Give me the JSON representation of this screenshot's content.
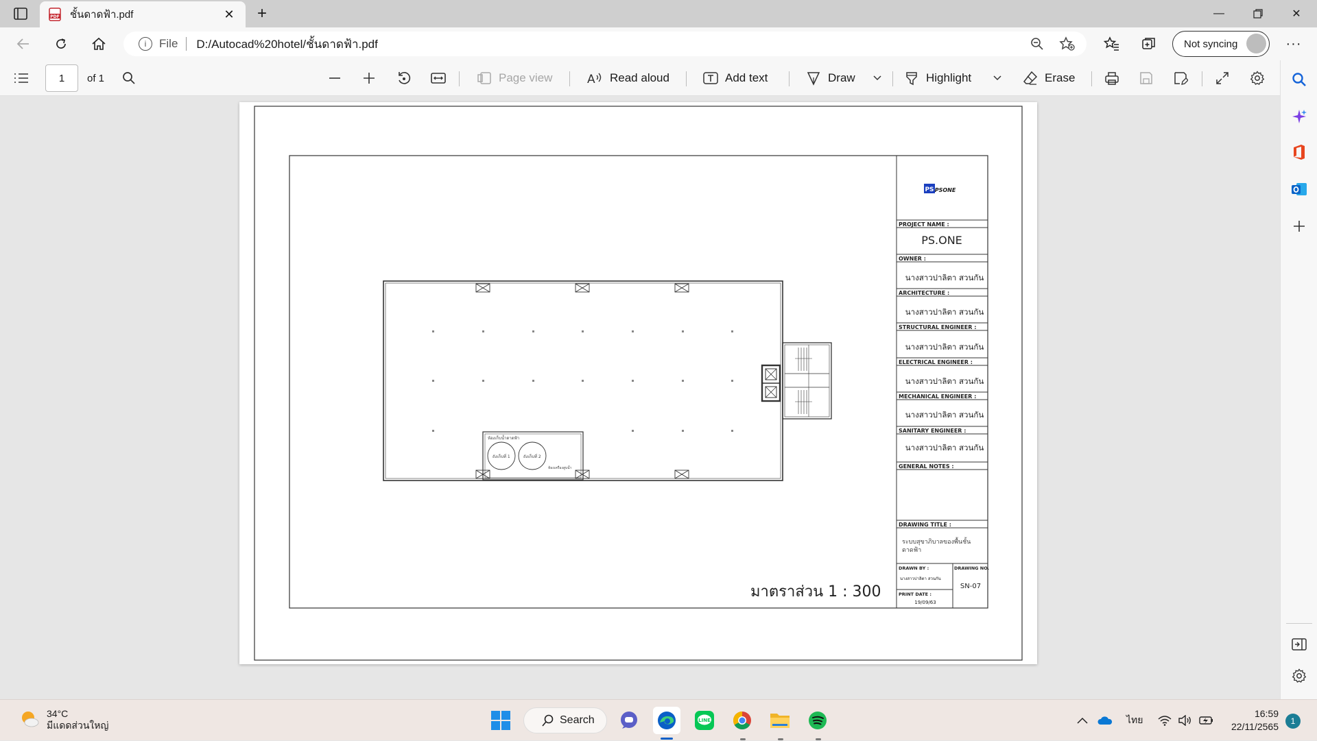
{
  "browser": {
    "tab_title": "ชั้นดาดฟ้า.pdf",
    "address_scheme": "File",
    "url": "D:/Autocad%20hotel/ชั้นดาดฟ้า.pdf",
    "profile_label": "Not syncing"
  },
  "pdf_toolbar": {
    "page_number": "1",
    "page_total": "of 1",
    "page_view": "Page view",
    "read_aloud": "Read aloud",
    "add_text": "Add text",
    "draw": "Draw",
    "highlight": "Highlight",
    "erase": "Erase"
  },
  "drawing": {
    "logo": "PSONE",
    "project_name_label": "PROJECT NAME :",
    "project_name": "PS.ONE",
    "owner_label": "OWNER :",
    "owner": "นางสาวปาลิตา สวนกัน",
    "architecture_label": "ARCHITECTURE :",
    "architecture": "นางสาวปาลิตา สวนกัน",
    "structural_label": "STRUCTURAL ENGINEER :",
    "structural": "นางสาวปาลิตา สวนกัน",
    "electrical_label": "ELECTRICAL ENGINEER :",
    "electrical": "นางสาวปาลิตา สวนกัน",
    "mechanical_label": "MECHANICAL ENGINEER :",
    "mechanical": "นางสาวปาลิตา สวนกัน",
    "sanitary_label": "SANITARY ENGINEER :",
    "sanitary": "นางสาวปาลิตา สวนกัน",
    "general_notes_label": "GENERAL NOTES :",
    "drawing_title_label": "DRAWING TITLE :",
    "drawing_title_line1": "ระบบสุขาภิบาลของพื้นชั้น",
    "drawing_title_line2": "ดาดฟ้า",
    "drawn_by_label": "DRAWN BY :",
    "drawn_by": "นางสาวปาลิตา สวนกัน",
    "drawing_no_label": "DRAWING NO.",
    "drawing_no": "SN-07",
    "print_date_label": "PRINT DATE :",
    "print_date": "19/09/63",
    "scale": "มาตราส่วน 1 : 300",
    "tank_room_label": "ห้องเก็บน้ำดาดฟ้า",
    "tank1": "ถังเก็บที่ 1",
    "tank2": "ถังเก็บที่ 2",
    "pump_label": "ห้องเครื่องสูบน้ำ"
  },
  "taskbar": {
    "temperature": "34°C",
    "weather_desc": "มีแดดส่วนใหญ่",
    "search_label": "Search",
    "language": "ไทย",
    "time": "16:59",
    "date": "22/11/2565",
    "notification_count": "1"
  },
  "colors": {
    "edge_blue": "#0a5fc7",
    "line_green": "#06c755",
    "spotify_green": "#1db954"
  }
}
